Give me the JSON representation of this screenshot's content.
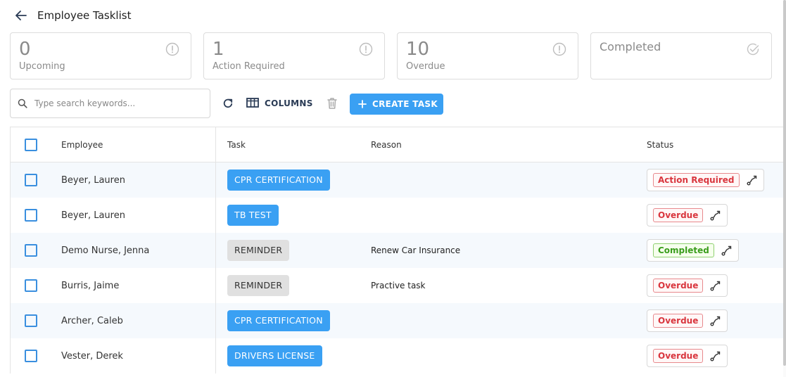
{
  "header": {
    "title": "Employee Tasklist",
    "back_icon": "arrow-left-icon"
  },
  "cards": [
    {
      "count": "0",
      "label": "Upcoming",
      "icon": "alert-circle-icon"
    },
    {
      "count": "1",
      "label": "Action Required",
      "icon": "alert-circle-icon"
    },
    {
      "count": "10",
      "label": "Overdue",
      "icon": "alert-circle-icon"
    },
    {
      "count": "",
      "label": "Completed",
      "icon": "check-circle-icon"
    }
  ],
  "toolbar": {
    "search_placeholder": "Type search keywords...",
    "columns_label": "COLUMNS",
    "create_label": "CREATE TASK"
  },
  "table": {
    "headers": {
      "employee": "Employee",
      "task": "Task",
      "reason": "Reason",
      "status": "Status"
    },
    "rows": [
      {
        "employee": "Beyer, Lauren",
        "task": "CPR CERTIFICATION",
        "task_style": "blue",
        "reason": "",
        "status": "Action Required",
        "status_style": "red"
      },
      {
        "employee": "Beyer, Lauren",
        "task": "TB TEST",
        "task_style": "blue",
        "reason": "",
        "status": "Overdue",
        "status_style": "red"
      },
      {
        "employee": "Demo Nurse, Jenna",
        "task": "REMINDER",
        "task_style": "gray",
        "reason": "Renew Car Insurance",
        "status": "Completed",
        "status_style": "green"
      },
      {
        "employee": "Burris, Jaime",
        "task": "REMINDER",
        "task_style": "gray",
        "reason": "Practive task",
        "status": "Overdue",
        "status_style": "red"
      },
      {
        "employee": "Archer, Caleb",
        "task": "CPR CERTIFICATION",
        "task_style": "blue",
        "reason": "",
        "status": "Overdue",
        "status_style": "red"
      },
      {
        "employee": "Vester, Derek",
        "task": "DRIVERS LICENSE",
        "task_style": "blue",
        "reason": "",
        "status": "Overdue",
        "status_style": "red"
      }
    ]
  },
  "colors": {
    "accent": "#3aa0f3",
    "overdue": "#d9363e",
    "completed": "#3a9d1c"
  }
}
